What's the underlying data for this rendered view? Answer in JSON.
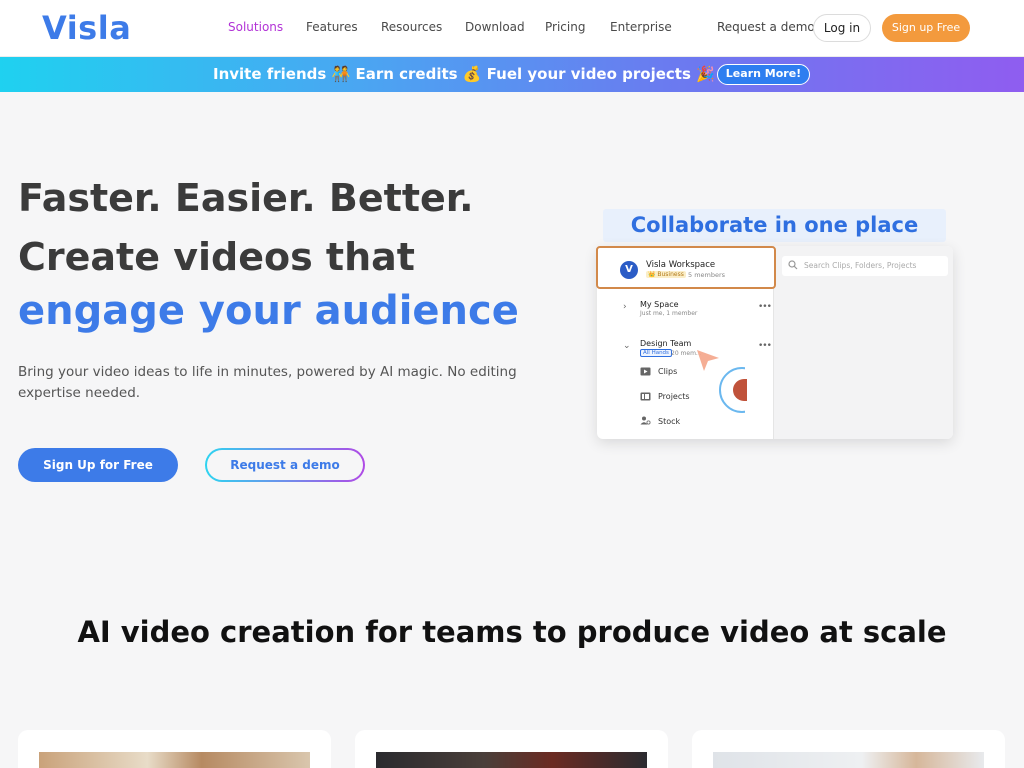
{
  "nav": {
    "logo": "Visla",
    "links": [
      "Solutions",
      "Features",
      "Resources",
      "Download",
      "Pricing",
      "Enterprise"
    ],
    "active_link": "Solutions",
    "request_demo": "Request a demo",
    "login": "Log in",
    "signup": "Sign up Free"
  },
  "banner": {
    "text": "Invite friends 🧑‍🤝‍🧑 Earn credits 💰 Fuel your video projects 🎉",
    "button": "Learn More!"
  },
  "hero": {
    "line1": "Faster. Easier. Better.",
    "line2": "Create videos that",
    "line3": "engage your audience",
    "subtitle": "Bring your video ideas to life in minutes, powered by AI magic. No editing expertise needed.",
    "primary_button": "Sign Up for Free",
    "secondary_button": "Request a demo"
  },
  "collab": {
    "title": "Collaborate in one place",
    "workspace_name": "Visla Workspace",
    "workspace_badge": "👑 Business",
    "workspace_members": "5 members",
    "search_placeholder": "Search Clips, Folders, Projects",
    "my_space": {
      "title": "My Space",
      "sub": "Just me, 1 member"
    },
    "design_team": {
      "title": "Design Team",
      "tag": "All Hands",
      "sub": "20 mem..."
    },
    "sub_items": [
      "Clips",
      "Projects",
      "Stock"
    ]
  },
  "section2": {
    "title": "AI video creation for teams to produce video at scale"
  },
  "colors": {
    "brand_blue": "#3d7be8",
    "signup_orange": "#f39a3d",
    "active_purple": "#b233d6"
  }
}
